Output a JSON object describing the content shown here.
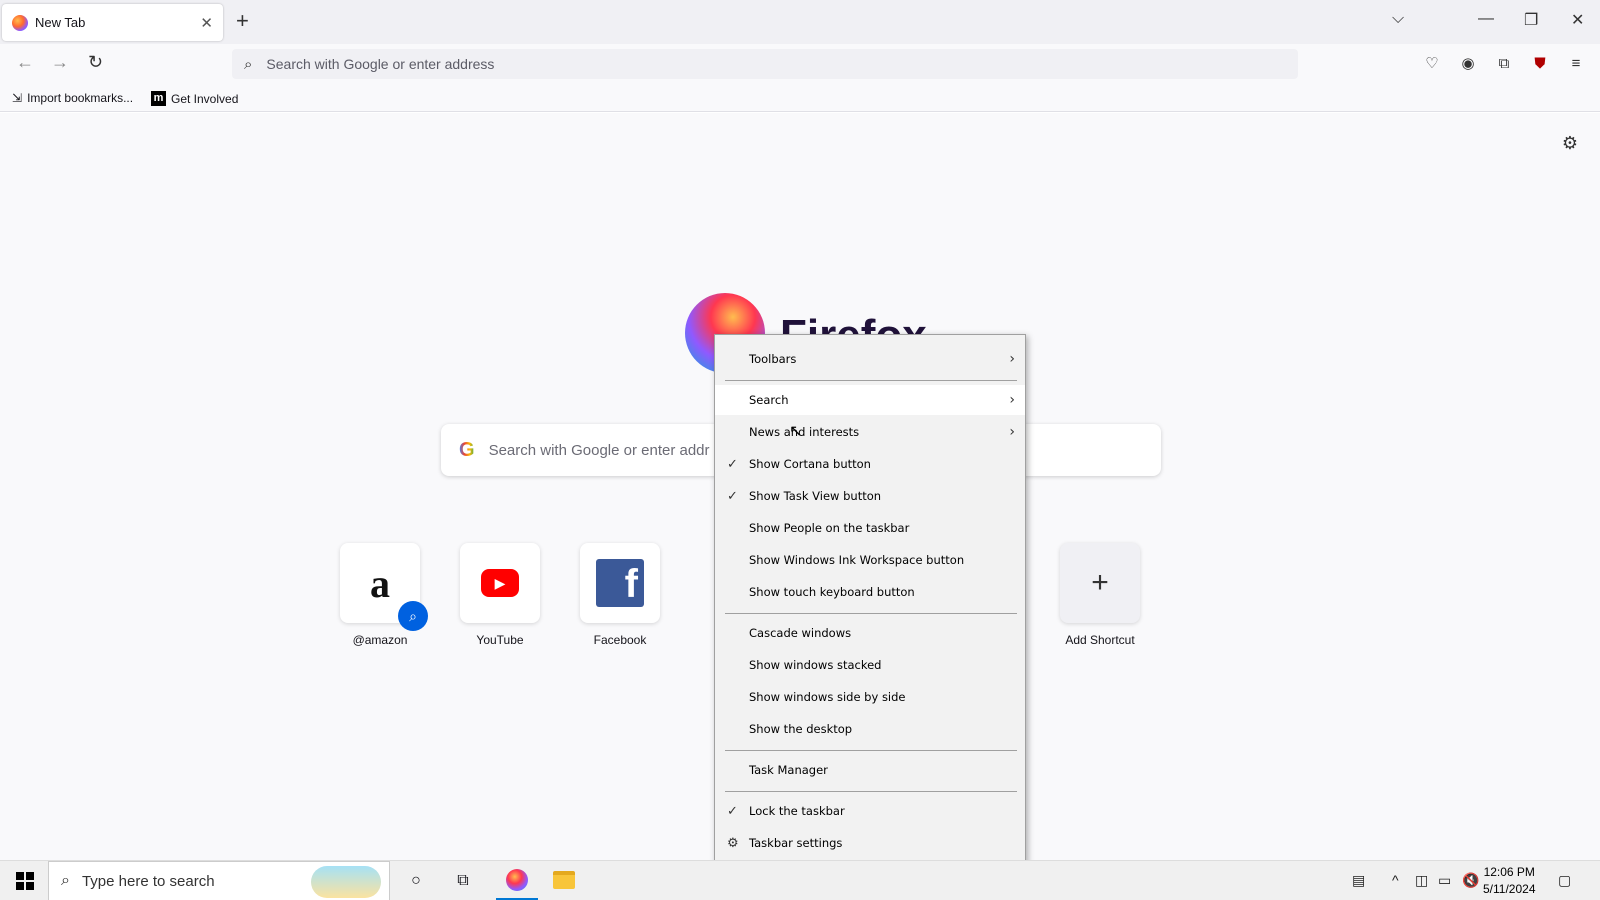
{
  "browser": {
    "tab_title": "New Tab",
    "url_placeholder": "Search with Google or enter address",
    "bookmarks": [
      "Import bookmarks...",
      "Get Involved"
    ]
  },
  "newtab": {
    "logo_text": "Firefox",
    "search_placeholder": "Search with Google or enter addr",
    "shortcuts": [
      {
        "label": "@amazon"
      },
      {
        "label": "YouTube"
      },
      {
        "label": "Facebook"
      },
      {
        "label": "Add Shortcut"
      }
    ]
  },
  "context_menu": {
    "items": [
      {
        "label": "Toolbars",
        "submenu": true
      },
      {
        "label": "Search",
        "submenu": true
      },
      {
        "label": "News and interests",
        "submenu": true
      },
      {
        "label": "Show Cortana button",
        "checked": true
      },
      {
        "label": "Show Task View button",
        "checked": true
      },
      {
        "label": "Show People on the taskbar"
      },
      {
        "label": "Show Windows Ink Workspace button"
      },
      {
        "label": "Show touch keyboard button"
      },
      {
        "label": "Cascade windows"
      },
      {
        "label": "Show windows stacked"
      },
      {
        "label": "Show windows side by side"
      },
      {
        "label": "Show the desktop"
      },
      {
        "label": "Task Manager"
      },
      {
        "label": "Lock the taskbar",
        "checked": true
      },
      {
        "label": "Taskbar settings"
      }
    ]
  },
  "taskbar": {
    "search_placeholder": "Type here to search",
    "time": "12:06 PM",
    "date": "5/11/2024"
  }
}
